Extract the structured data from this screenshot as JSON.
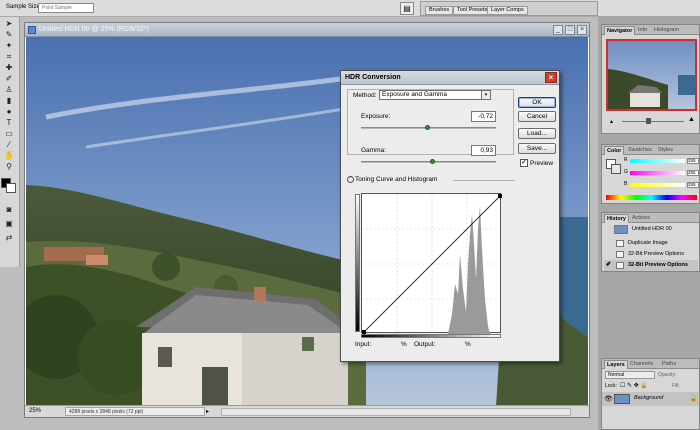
{
  "options_bar": {
    "sample_size_label": "Sample Size:",
    "sample_size_value": "Point Sample"
  },
  "palette_well": {
    "tabs": [
      "Brushes",
      "Tool Presets",
      "Layer Comps"
    ]
  },
  "document": {
    "title": "Untitled HDR 00 @ 25% (RGB/32*)",
    "zoom": "25%",
    "info": "4288 pixels x 2848 pixels (72 ppi)"
  },
  "hdr_dialog": {
    "title": "HDR Conversion",
    "method_label": "Method:",
    "method_value": "Exposure and Gamma",
    "exposure_label": "Exposure:",
    "exposure_value": "-0,72",
    "gamma_label": "Gamma:",
    "gamma_value": "0,93",
    "toning_label": "Toning Curve and Histogram",
    "input_label": "Input:",
    "input_unit": "%",
    "output_label": "Output:",
    "output_unit": "%",
    "buttons": {
      "ok": "OK",
      "cancel": "Cancel",
      "load": "Load...",
      "save": "Save..."
    },
    "preview_label": "Preview",
    "preview_checked": true
  },
  "navigator_panel": {
    "tabs": [
      "Navigator",
      "Info",
      "Histogram"
    ]
  },
  "color_panel": {
    "tabs": [
      "Color",
      "Swatches",
      "Styles"
    ],
    "channels": [
      {
        "name": "R",
        "value": "255"
      },
      {
        "name": "G",
        "value": "255"
      },
      {
        "name": "B",
        "value": "255"
      }
    ]
  },
  "history_panel": {
    "tabs": [
      "History",
      "Actions"
    ],
    "snapshot": "Untitled HDR 00",
    "items": [
      "Duplicate Image",
      "32-Bit Preview Options",
      "32-Bit Preview Options"
    ]
  },
  "layers_panel": {
    "tabs": [
      "Layers",
      "Channels",
      "Paths"
    ],
    "blend_mode": "Normal",
    "opacity_label": "Opacity:",
    "lock_label": "Lock:",
    "fill_label": "Fill:",
    "layer_name": "Background"
  },
  "colors": {
    "accent_close": "#c9402d",
    "slider_thumb": "#3b8d3b",
    "sky_top": "#4e74b4",
    "histogram": "#9a9a9a"
  }
}
